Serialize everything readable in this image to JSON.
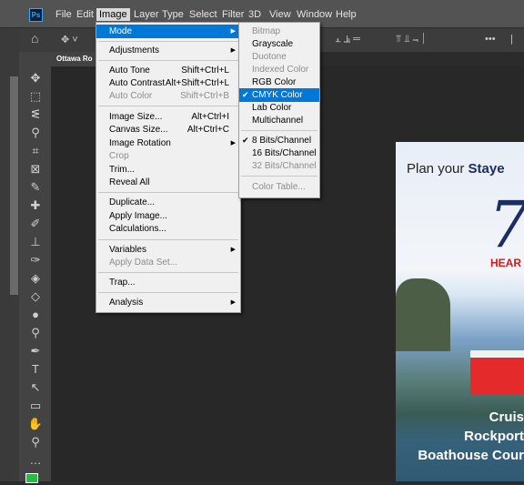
{
  "app": {
    "logo": "Ps"
  },
  "menubar": [
    "File",
    "Edit",
    "Image",
    "Layer",
    "Type",
    "Select",
    "Filter",
    "3D",
    "View",
    "Window",
    "Help"
  ],
  "tab": {
    "title": "Ottawa Ro"
  },
  "image_menu": {
    "items": [
      {
        "label": "Mode",
        "shortcut": "",
        "submenu": true,
        "highlighted": true
      },
      {
        "label": "Adjustments",
        "shortcut": "",
        "submenu": true
      },
      {
        "label": "Auto Tone",
        "shortcut": "Shift+Ctrl+L"
      },
      {
        "label": "Auto Contrast",
        "shortcut": "Alt+Shift+Ctrl+L"
      },
      {
        "label": "Auto Color",
        "shortcut": "Shift+Ctrl+B",
        "disabled": true
      },
      {
        "label": "Image Size...",
        "shortcut": "Alt+Ctrl+I"
      },
      {
        "label": "Canvas Size...",
        "shortcut": "Alt+Ctrl+C"
      },
      {
        "label": "Image Rotation",
        "shortcut": "",
        "submenu": true
      },
      {
        "label": "Crop",
        "shortcut": "",
        "disabled": true
      },
      {
        "label": "Trim...",
        "shortcut": ""
      },
      {
        "label": "Reveal All",
        "shortcut": ""
      },
      {
        "label": "Duplicate...",
        "shortcut": ""
      },
      {
        "label": "Apply Image...",
        "shortcut": ""
      },
      {
        "label": "Calculations...",
        "shortcut": ""
      },
      {
        "label": "Variables",
        "shortcut": "",
        "submenu": true
      },
      {
        "label": "Apply Data Set...",
        "shortcut": "",
        "disabled": true
      },
      {
        "label": "Trap...",
        "shortcut": ""
      },
      {
        "label": "Analysis",
        "shortcut": "",
        "submenu": true
      }
    ]
  },
  "mode_submenu": {
    "items": [
      {
        "label": "Bitmap",
        "disabled": true
      },
      {
        "label": "Grayscale"
      },
      {
        "label": "Duotone",
        "disabled": true
      },
      {
        "label": "Indexed Color",
        "disabled": true
      },
      {
        "label": "RGB Color"
      },
      {
        "label": "CMYK Color",
        "checked": true,
        "highlighted": true
      },
      {
        "label": "Lab Color"
      },
      {
        "label": "Multichannel"
      },
      {
        "label": "8 Bits/Channel",
        "checked": true
      },
      {
        "label": "16 Bits/Channel"
      },
      {
        "label": "32 Bits/Channel",
        "disabled": true
      },
      {
        "label": "Color Table...",
        "disabled": true
      }
    ]
  },
  "poster": {
    "plan_prefix": "Plan your ",
    "plan_bold": "Staye",
    "big_number": "7",
    "hear": "HEAR",
    "line1": "Cruis",
    "line2": "Rockport",
    "line3": "Boathouse Cour"
  },
  "colors": {
    "highlight": "#0078d7",
    "menu_bg": "#f0f0f0",
    "brand": "#31a8ff",
    "foreground_swatch": "#20c040"
  }
}
